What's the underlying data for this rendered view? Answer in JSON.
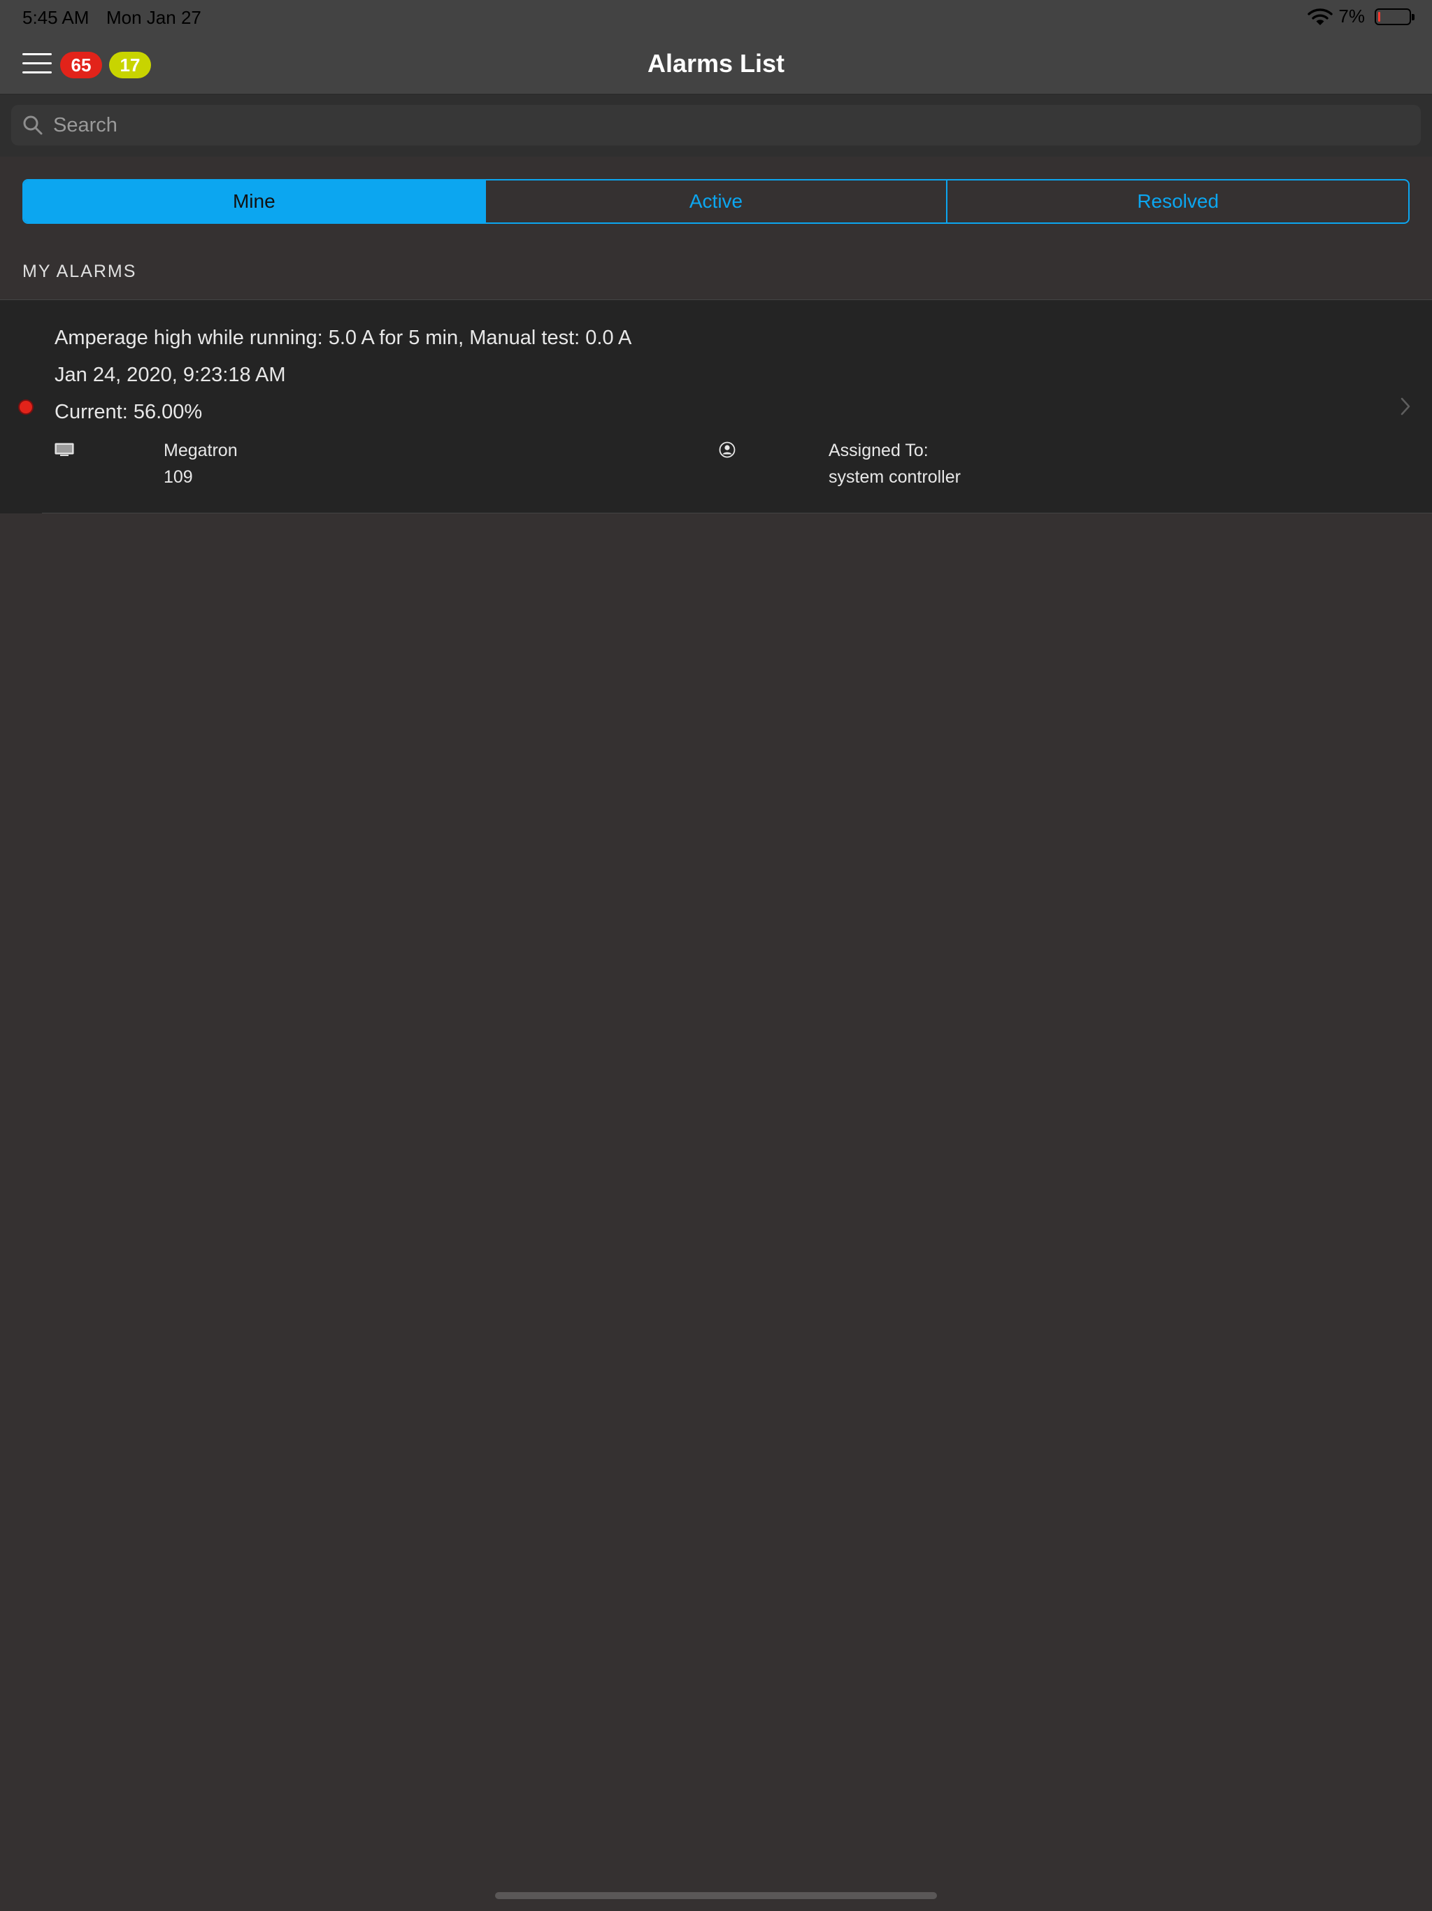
{
  "status_bar": {
    "time": "5:45 AM",
    "date": "Mon Jan 27",
    "battery_percent": "7%",
    "battery_level": 0.07,
    "icons": [
      "wifi-icon",
      "battery-icon"
    ]
  },
  "nav": {
    "title": "Alarms List",
    "badges": {
      "critical_count": "65",
      "warning_count": "17"
    },
    "colors": {
      "critical": "#e2231a",
      "warning": "#c8d400"
    }
  },
  "search": {
    "placeholder": "Search",
    "value": ""
  },
  "tabs": [
    {
      "label": "Mine",
      "active": true
    },
    {
      "label": "Active",
      "active": false
    },
    {
      "label": "Resolved",
      "active": false
    }
  ],
  "accent_color": "#0ca6f0",
  "section": {
    "header": "MY ALARMS"
  },
  "alarms": [
    {
      "title": "Amperage high while running: 5.0 A for 5 min, Manual test: 0.0 A",
      "timestamp": "Jan 24, 2020, 9:23:18 AM",
      "current": "Current: 56.00%",
      "device_name": "Megatron",
      "device_id": "109",
      "assigned_label": "Assigned To:",
      "assigned_to": "system controller",
      "severity_color": "#e2231a"
    }
  ]
}
